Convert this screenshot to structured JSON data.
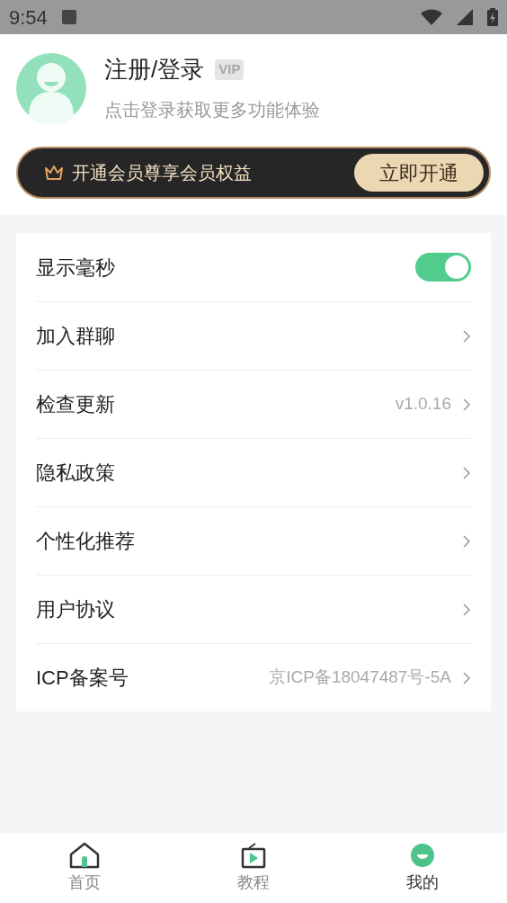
{
  "status_bar": {
    "time": "9:54"
  },
  "profile": {
    "title": "注册/登录",
    "badge": "VIP",
    "subtitle": "点击登录获取更多功能体验"
  },
  "vip_banner": {
    "text": "开通会员尊享会员权益",
    "button": "立即开通"
  },
  "settings": [
    {
      "kind": "toggle",
      "label": "显示毫秒",
      "on": true
    },
    {
      "kind": "link",
      "label": "加入群聊"
    },
    {
      "kind": "link",
      "label": "检查更新",
      "value": "v1.0.16"
    },
    {
      "kind": "link",
      "label": "隐私政策"
    },
    {
      "kind": "link",
      "label": "个性化推荐"
    },
    {
      "kind": "link",
      "label": "用户协议"
    },
    {
      "kind": "link",
      "label": "ICP备案号",
      "value": "京ICP备18047487号-5A"
    }
  ],
  "tabs": [
    {
      "label": "首页",
      "selected": false
    },
    {
      "label": "教程",
      "selected": false
    },
    {
      "label": "我的",
      "selected": true
    }
  ]
}
